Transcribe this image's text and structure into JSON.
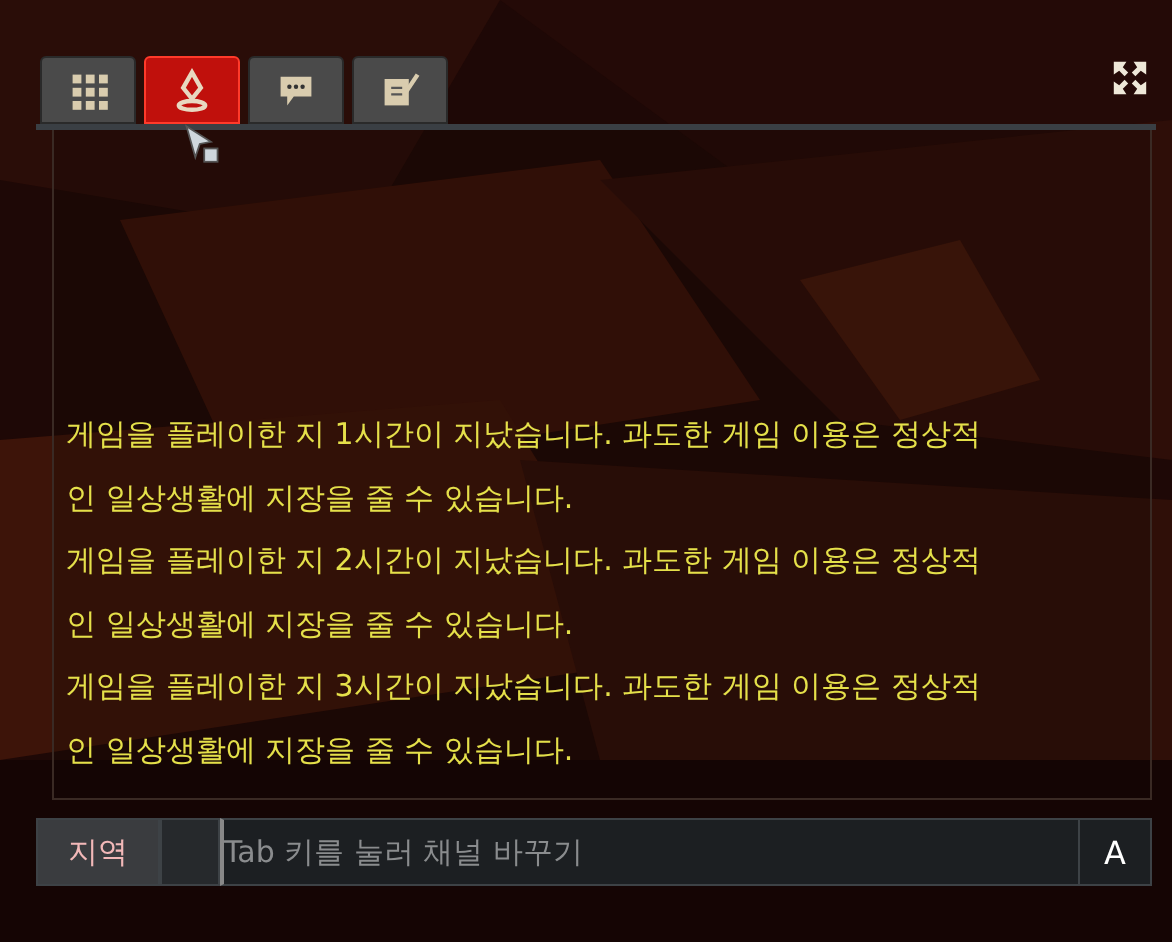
{
  "tabs": [
    {
      "kind": "grid",
      "selected": false
    },
    {
      "kind": "pin",
      "selected": true
    },
    {
      "kind": "speech",
      "selected": false
    },
    {
      "kind": "note",
      "selected": false
    }
  ],
  "messages": [
    {
      "text": "게임을 플레이한 지 1시간이 지났습니다. 과도한 게임 이용은 정상적인 일상생활에 지장을 줄 수 있습니다."
    },
    {
      "text": "게임을 플레이한 지 2시간이 지났습니다. 과도한 게임 이용은 정상적인 일상생활에 지장을 줄 수 있습니다."
    },
    {
      "text": "게임을 플레이한 지 3시간이 지났습니다. 과도한 게임 이용은 정상적인 일상생활에 지장을 줄 수 있습니다."
    }
  ],
  "input": {
    "channel": "지역",
    "placeholder": "Tab 키를 눌러 채널 바꾸기",
    "ime": "A"
  }
}
